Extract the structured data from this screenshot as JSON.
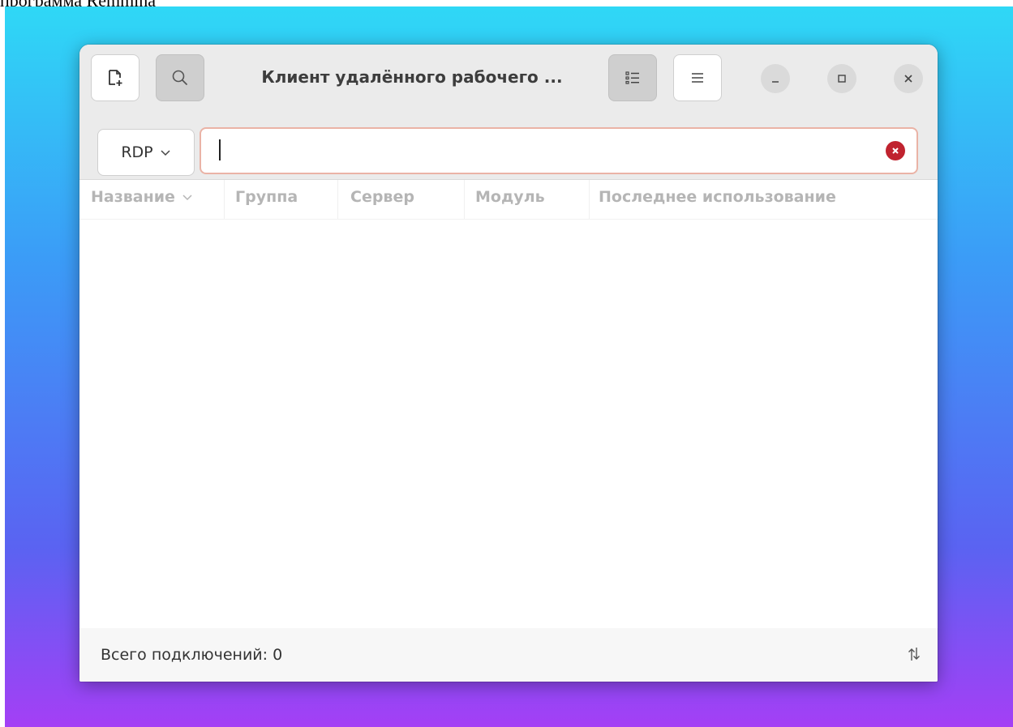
{
  "document": {
    "caption": "программа Remmina"
  },
  "window": {
    "title": "Клиент удалённого рабочего ..."
  },
  "headerbar": {
    "new_connection_icon": "new-file-icon",
    "search_icon": "search-icon",
    "view_list_icon": "list-view-icon",
    "menu_icon": "hamburger-menu-icon"
  },
  "window_controls": {
    "minimize_icon": "minimize-icon",
    "maximize_icon": "maximize-icon",
    "close_icon": "close-icon"
  },
  "search": {
    "protocol": "RDP",
    "value": "",
    "placeholder": "",
    "clear_icon": "clear-icon"
  },
  "columns": [
    {
      "label": "Название",
      "sorted": true
    },
    {
      "label": "Группа"
    },
    {
      "label": "Сервер"
    },
    {
      "label": "Модуль"
    },
    {
      "label": "Последнее использование"
    }
  ],
  "status": {
    "text": "Всего подключений: 0"
  },
  "colors": {
    "accent_clear": "#c0232f",
    "search_focus_border": "#eab3a6",
    "headerbar_bg": "#ebebeb"
  }
}
